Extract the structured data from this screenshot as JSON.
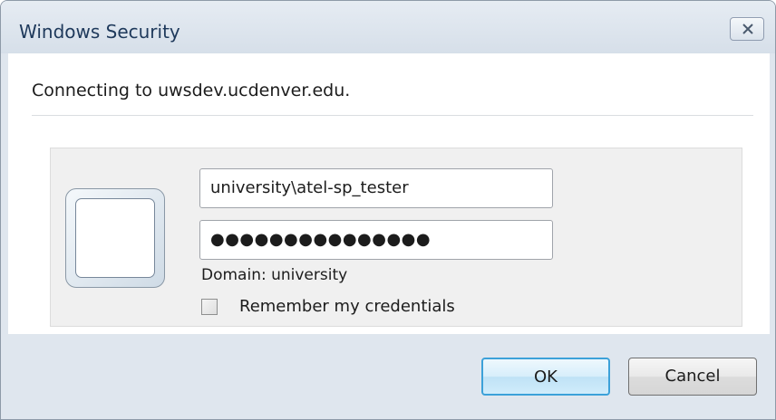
{
  "window": {
    "title": "Windows Security",
    "close_label": "Close"
  },
  "message": {
    "connecting": "Connecting to uwsdev.ucdenver.edu."
  },
  "credentials": {
    "username": "university\\atel-sp_tester",
    "password_masked": "●●●●●●●●●●●●●●●",
    "domain": "Domain: university",
    "remember_label": "Remember my credentials",
    "remember_checked": false
  },
  "buttons": {
    "ok": "OK",
    "cancel": "Cancel"
  },
  "colors": {
    "frame": "#dfe6ee",
    "title_text": "#1e395b",
    "ok_border": "#3ca1d9"
  }
}
